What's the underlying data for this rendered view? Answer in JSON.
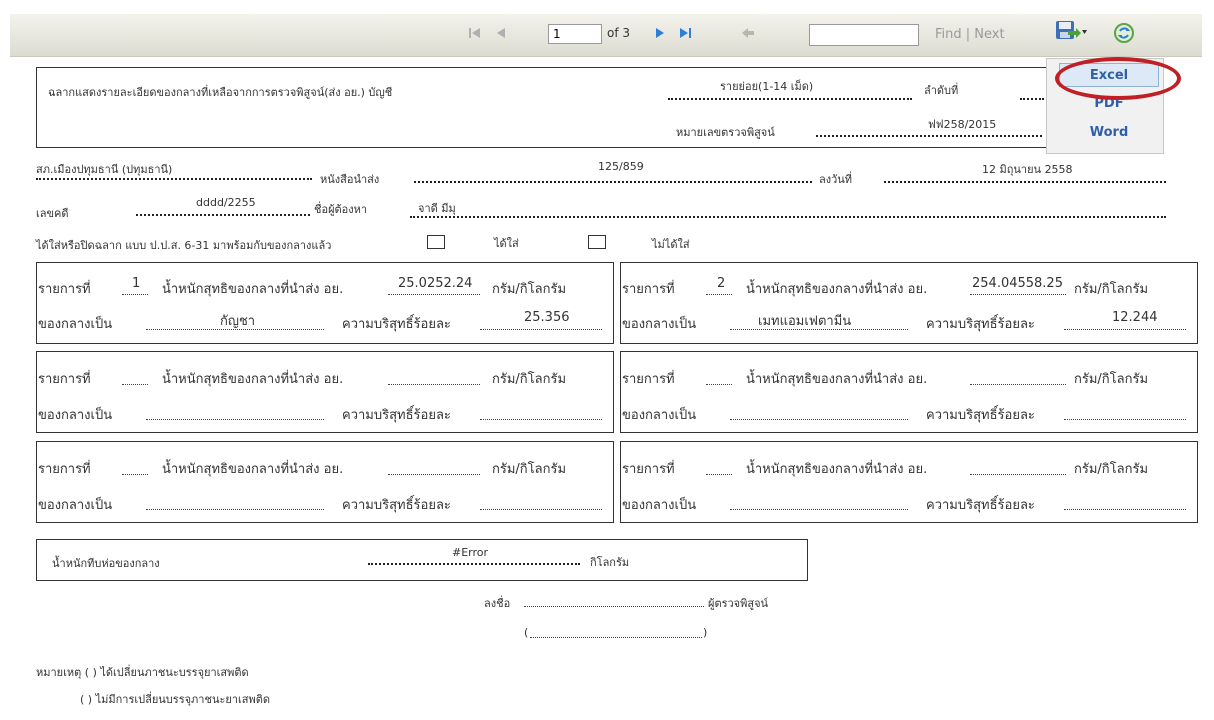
{
  "toolbar": {
    "page_number": "1",
    "of_label": "of 3",
    "find_label": "Find | Next",
    "icons": [
      "first-page-icon",
      "prev-page-icon",
      "next-page-icon",
      "last-page-icon",
      "back-icon",
      "export-save-icon",
      "refresh-icon"
    ]
  },
  "export_menu": {
    "items": [
      "Excel",
      "PDF",
      "Word"
    ],
    "highlight_color": "#c01f25"
  },
  "header": {
    "title": "ฉลากแสดงรายละเอียดของกลางที่เหลือจากการตรวจพิสูจน์(ส่ง อย.) บัญชี",
    "summary": "รายย่อย(1-14 เม็ด)",
    "order_label": "ลำดับที่",
    "exam_no_label": "หมายเลขตรวจพิสูจน์",
    "exam_no": "ฟฟ258/2015"
  },
  "info": {
    "station": "สภ.เมืองปทุมธานี (ปทุมธานี)",
    "letter_label": "หนังสือนำส่ง",
    "letter_no": "125/859",
    "date_label": "ลงวันที่",
    "date": "12 มิถุนายน 2558",
    "case_label": "เลขคดี",
    "case_no": "dddd/2255",
    "suspect_label": "ชื่อผู้ต้องหา",
    "suspect": "จาดี มีมุ",
    "seal_text": "ได้ใส่หรือปิดฉลาก แบบ ป.ป.ส. 6-31 มาพร้อมกับของกลางแล้ว",
    "seal_yes": "ได้ใส่",
    "seal_no": "ไม่ได้ใส่"
  },
  "labels": {
    "item": "รายการที่",
    "weight": "น้ำหนักสุทธิของกลางที่นำส่ง อย.",
    "unit": "กรัม/กิโลกรัม",
    "type": "ของกลางเป็น",
    "purity": "ความบริสุทธิ์ร้อยละ"
  },
  "items": [
    {
      "no": "1",
      "weight": "25.0252.24",
      "type": "กัญชา",
      "purity": "25.356"
    },
    {
      "no": "2",
      "weight": "254.04558.25",
      "type": "เมทแอมเฟตามีน",
      "purity": "12.244"
    },
    {
      "no": "",
      "weight": "",
      "type": "",
      "purity": ""
    },
    {
      "no": "",
      "weight": "",
      "type": "",
      "purity": ""
    },
    {
      "no": "",
      "weight": "",
      "type": "",
      "purity": ""
    },
    {
      "no": "",
      "weight": "",
      "type": "",
      "purity": ""
    }
  ],
  "package": {
    "label": "น้ำหนักทีบห่อของกลาง",
    "value": "#Error",
    "unit": "กิโลกรัม"
  },
  "signature": {
    "sign_label": "ลงชื่อ",
    "examiner_label": "ผู้ตรวจพิสูจน์",
    "paren_open": "(",
    "paren_close": ")"
  },
  "notes": {
    "note1": "หมายเหตุ ( ) ได้เปลี่ยนภาชนะบรรจุยาเสพติด",
    "note2": "( ) ไม่มีการเปลี่ยนบรรจุภาชนะยาเสพติด"
  }
}
